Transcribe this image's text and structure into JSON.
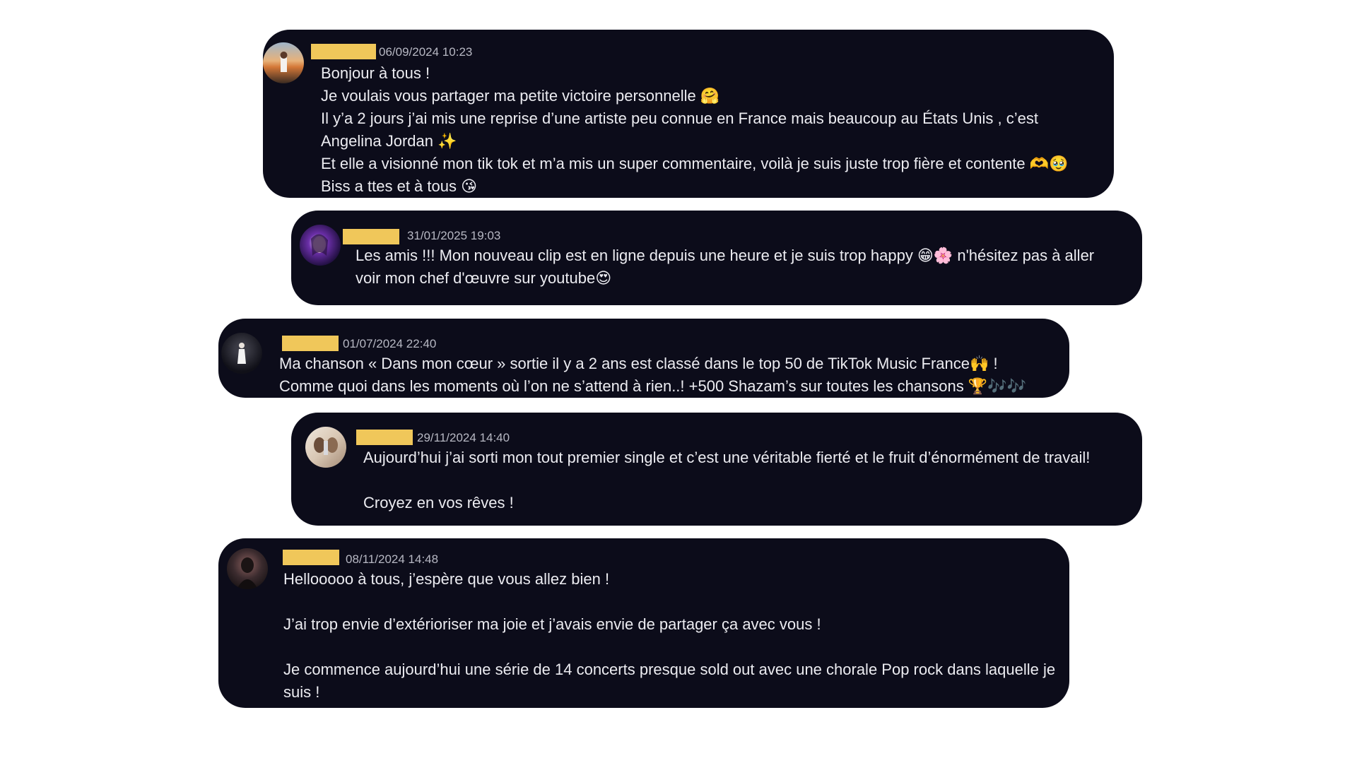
{
  "messages": [
    {
      "timestamp": "06/09/2024 10:23",
      "avatar": "sunset-portrait-avatar",
      "lines": [
        "Bonjour à tous !",
        "Je voulais vous partager ma petite victoire personnelle 🤗",
        "Il y’a 2 jours j’ai mis une reprise d’une artiste peu connue en France mais beaucoup au États Unis , c’est",
        "Angelina Jordan ✨",
        "Et elle a visionné mon tik tok et m’a mis un super commentaire, voilà je suis juste trop fière et contente 🫶🥹",
        "Biss a ttes et à tous 😘"
      ]
    },
    {
      "timestamp": "31/01/2025 19:03",
      "avatar": "purple-portrait-avatar",
      "lines": [
        "Les amis !!! Mon nouveau clip est en ligne depuis une heure et je suis trop happy 😁🌸 n'hésitez pas à aller",
        "voir mon chef d'œuvre sur youtube😍"
      ]
    },
    {
      "timestamp": "01/07/2024 22:40",
      "avatar": "stage-performer-avatar",
      "lines": [
        "Ma chanson « Dans mon cœur » sortie il y a 2 ans est classé dans le top 50 de TikTok Music France🙌 !",
        "Comme quoi dans les moments où l’on ne s’attend à rien..! +500 Shazam’s sur toutes les chansons 🏆🎶🎶"
      ]
    },
    {
      "timestamp": "29/11/2024 14:40",
      "avatar": "selfie-portrait-avatar",
      "lines": [
        "Aujourd’hui j’ai sorti mon tout premier single et c’est une véritable fierté et le fruit d’énormément de travail!",
        "",
        "Croyez en vos rêves !"
      ]
    },
    {
      "timestamp": "08/11/2024 14:48",
      "avatar": "dark-portrait-avatar",
      "lines": [
        "Hellooooo à tous, j’espère que vous allez bien !",
        "",
        "J’ai trop envie d’extérioriser ma joie et j’avais envie de partager ça avec vous !",
        "",
        "Je commence aujourd’hui une série de 14 concerts presque sold out avec une chorale Pop rock dans laquelle je",
        "suis !"
      ]
    }
  ],
  "colors": {
    "bubble": "#0c0c1a",
    "redaction": "#f0c75a",
    "text": "#ececf1",
    "timestamp": "#b7b8c3"
  }
}
